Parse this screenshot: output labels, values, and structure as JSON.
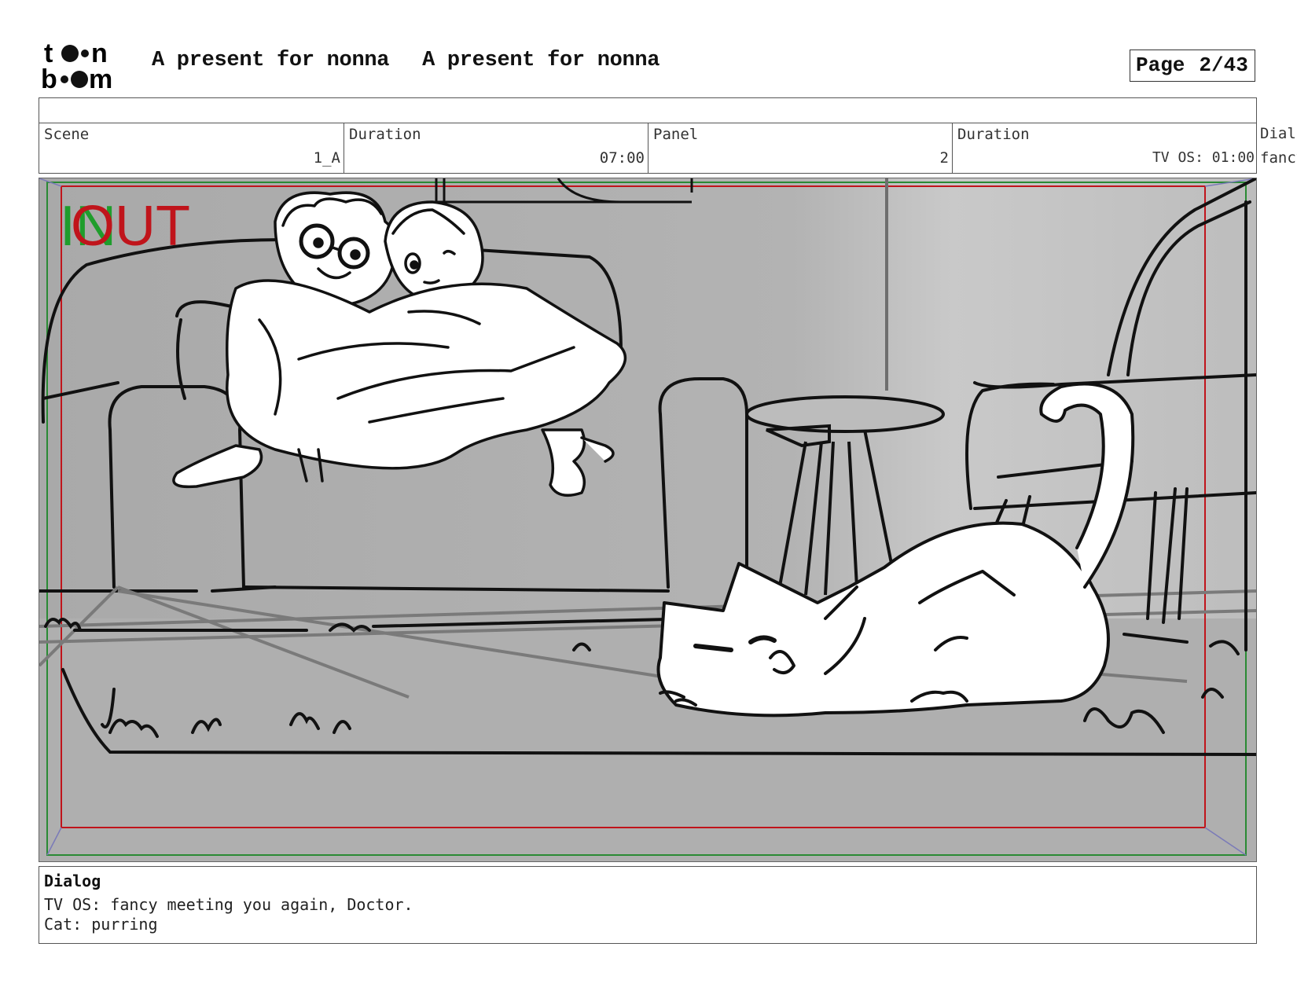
{
  "header": {
    "logo_text": "toon boom",
    "project_title": "A present for nonna",
    "episode_title": "A present for nonna",
    "page_label": "Page",
    "page_number": "2/43"
  },
  "info_bar": {
    "scene_label": "Scene",
    "scene_value": "1_A",
    "scene_duration_label": "Duration",
    "scene_duration_value": "07:00",
    "panel_label": "Panel",
    "panel_value": "2",
    "panel_duration_label": "Duration",
    "panel_duration_value": "TV OS: 01:00",
    "dialog_label_cut": "Dial",
    "dialog_value_cut": "fancy"
  },
  "panel_image": {
    "in_marker": "IN",
    "out_marker": "OUT",
    "colors": {
      "in": "#1f9d2c",
      "out": "#c0141b",
      "background": "#b0b0b0"
    }
  },
  "dialog": {
    "heading": "Dialog",
    "lines": [
      "TV OS: fancy meeting you again, Doctor.",
      "Cat: purring"
    ]
  }
}
